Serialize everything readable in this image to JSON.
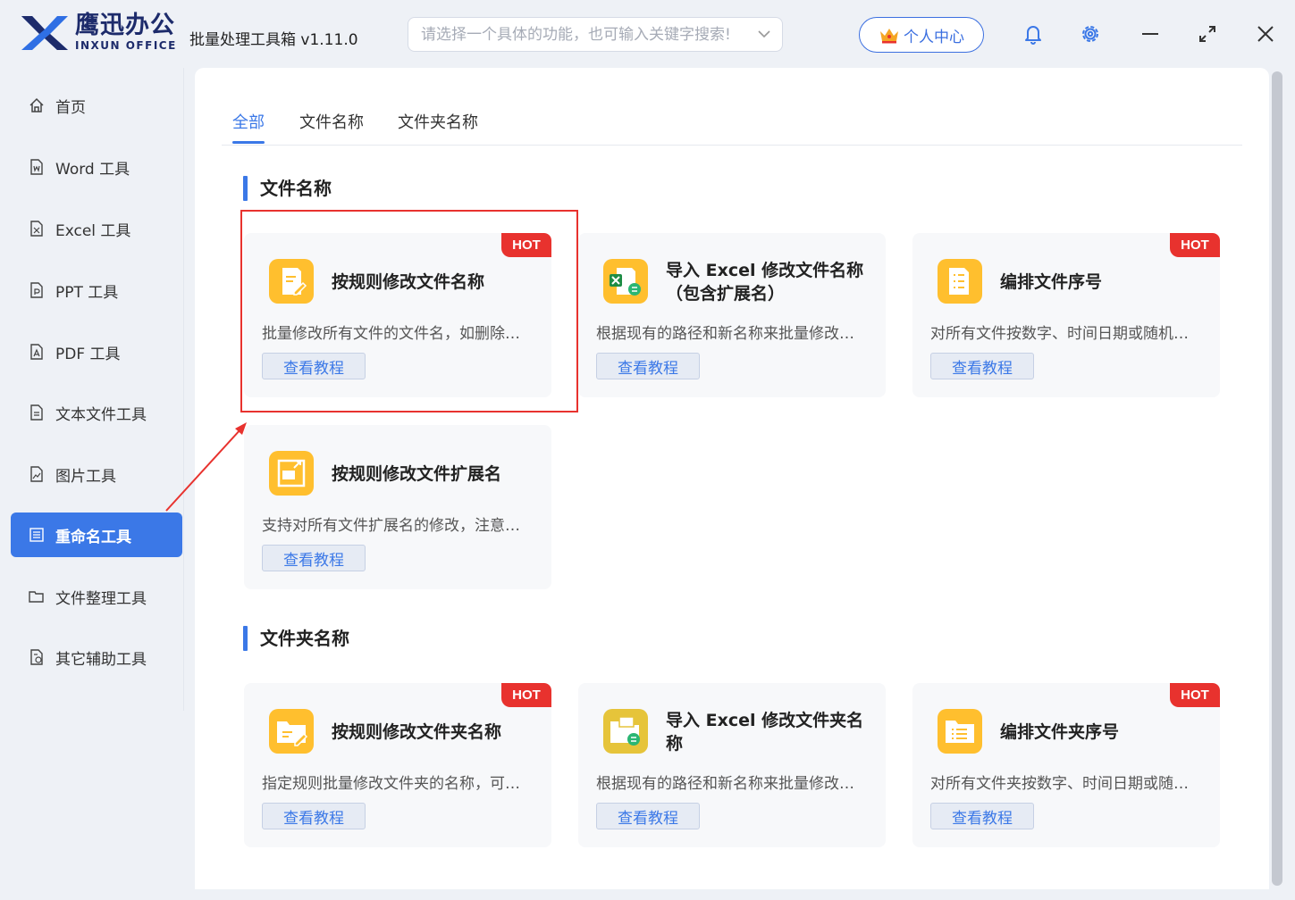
{
  "brand": {
    "name_cn": "鹰迅办公",
    "name_en": "INXUN OFFICE"
  },
  "app_title": "批量处理工具箱 v1.11.0",
  "search": {
    "placeholder": "请选择一个具体的功能，也可输入关键字搜索!"
  },
  "header": {
    "user_center": "个人中心"
  },
  "colors": {
    "accent": "#3b78e7",
    "hot": "#e8322e",
    "icon_orange": "#ffbf2e"
  },
  "sidebar": {
    "items": [
      {
        "label": "首页",
        "icon": "home-icon"
      },
      {
        "label": "Word 工具",
        "icon": "word-file-icon"
      },
      {
        "label": "Excel 工具",
        "icon": "excel-file-icon"
      },
      {
        "label": "PPT 工具",
        "icon": "ppt-file-icon"
      },
      {
        "label": "PDF 工具",
        "icon": "pdf-file-icon"
      },
      {
        "label": "文本文件工具",
        "icon": "text-file-icon"
      },
      {
        "label": "图片工具",
        "icon": "image-file-icon"
      },
      {
        "label": "重命名工具",
        "icon": "rename-icon",
        "active": true
      },
      {
        "label": "文件整理工具",
        "icon": "folder-icon"
      },
      {
        "label": "其它辅助工具",
        "icon": "tools-icon"
      }
    ]
  },
  "tabs": [
    {
      "label": "全部",
      "active": true
    },
    {
      "label": "文件名称"
    },
    {
      "label": "文件夹名称"
    }
  ],
  "sections": [
    {
      "title": "文件名称",
      "cards": [
        {
          "title": "按规则修改文件名称",
          "desc": "批量修改所有文件的文件名，如删除…",
          "button": "查看教程",
          "hot": "HOT",
          "icon": "edit-file-icon"
        },
        {
          "title": "导入 Excel 修改文件名称（包含扩展名）",
          "desc": "根据现有的路径和新名称来批量修改…",
          "button": "查看教程",
          "icon": "excel-import-icon"
        },
        {
          "title": "编排文件序号",
          "desc": "对所有文件按数字、时间日期或随机…",
          "button": "查看教程",
          "hot": "HOT",
          "icon": "numbered-file-icon"
        },
        {
          "title": "按规则修改文件扩展名",
          "desc": "支持对所有文件扩展名的修改，注意…",
          "button": "查看教程",
          "icon": "file-extension-icon"
        }
      ]
    },
    {
      "title": "文件夹名称",
      "cards": [
        {
          "title": "按规则修改文件夹名称",
          "desc": "指定规则批量修改文件夹的名称，可…",
          "button": "查看教程",
          "hot": "HOT",
          "icon": "edit-folder-icon"
        },
        {
          "title": "导入 Excel 修改文件夹名称",
          "desc": "根据现有的路径和新名称来批量修改…",
          "button": "查看教程",
          "icon": "folder-import-icon"
        },
        {
          "title": "编排文件夹序号",
          "desc": "对所有文件夹按数字、时间日期或随…",
          "button": "查看教程",
          "hot": "HOT",
          "icon": "numbered-folder-icon"
        }
      ]
    }
  ]
}
